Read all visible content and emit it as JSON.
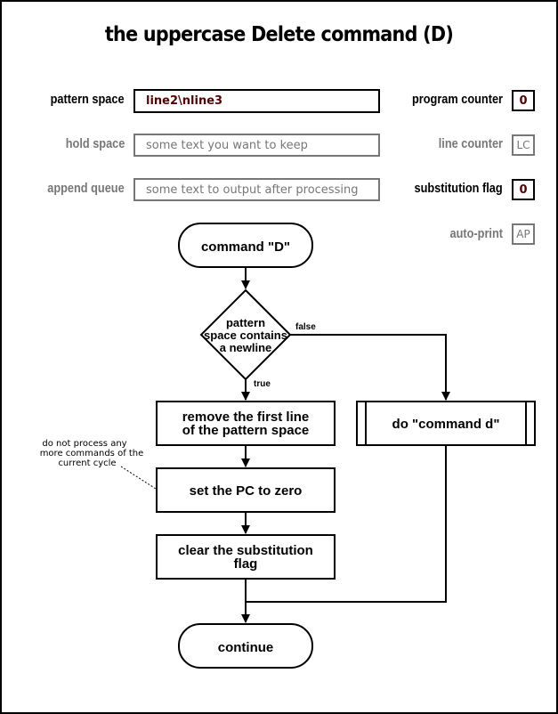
{
  "title": "the uppercase Delete command (D)",
  "state": {
    "pattern_space": {
      "label": "pattern space",
      "value": "line2\\nline3",
      "active": true
    },
    "hold_space": {
      "label": "hold space",
      "value": "some text you want to keep",
      "active": false
    },
    "append_queue": {
      "label": "append queue",
      "value": "some text to output after processing",
      "active": false
    },
    "program_counter": {
      "label": "program counter",
      "value": "0",
      "active": true
    },
    "line_counter": {
      "label": "line counter",
      "value": "LC",
      "active": false
    },
    "substitution_flag": {
      "label": "substitution flag",
      "value": "0",
      "active": true
    },
    "auto_print": {
      "label": "auto-print",
      "value": "AP",
      "active": false
    }
  },
  "flowchart": {
    "start": {
      "label": "command \"D\""
    },
    "decision": {
      "lines": [
        "pattern",
        "space contains",
        "a newline"
      ],
      "true_label": "true",
      "false_label": "false"
    },
    "step_remove": {
      "lines": [
        "remove the first line",
        "of the pattern space"
      ]
    },
    "step_pc": {
      "lines": [
        "set the PC to zero"
      ]
    },
    "step_clear": {
      "lines": [
        "clear the substitution",
        "flag"
      ]
    },
    "subroutine": {
      "label": "do \"command d\""
    },
    "end": {
      "label": "continue"
    },
    "note": {
      "lines": [
        "do not process any",
        "more commands of the",
        "current cycle"
      ]
    }
  },
  "colors": {
    "active": "#000000",
    "inactive": "#777777",
    "value": "#5a0000"
  }
}
